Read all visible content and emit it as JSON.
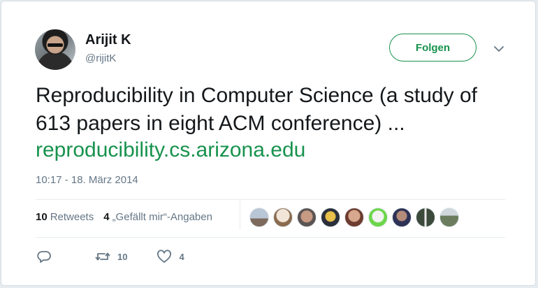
{
  "user": {
    "name": "Arijit K",
    "handle": "@rijitK"
  },
  "follow_label": "Folgen",
  "tweet": {
    "text": "Reproducibility in Computer Science (a study of 613 papers in eight ACM conference) ...",
    "link": "reproducibility.cs.arizona.edu",
    "timestamp": "10:17 - 18. März 2014"
  },
  "stats": {
    "retweets_count": "10",
    "retweets_label": "Retweets",
    "likes_count": "4",
    "likes_label": "„Gefällt mir“-Angaben"
  },
  "actions": {
    "retweet_count": "10",
    "like_count": "4"
  },
  "colors": {
    "accent": "#17924d",
    "text": "#14171a",
    "muted": "#657786"
  },
  "icons": [
    "chevron-down-icon",
    "reply-icon",
    "retweet-icon",
    "heart-icon"
  ]
}
